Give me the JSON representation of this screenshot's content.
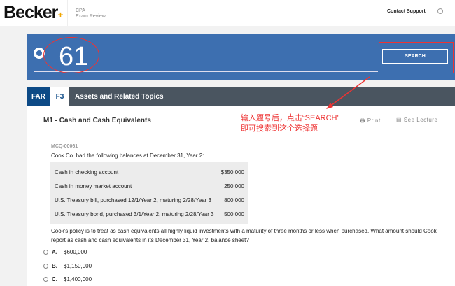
{
  "header": {
    "logo": "Becker",
    "product_line1": "CPA",
    "product_line2": "Exam Review",
    "contact": "Contact Support"
  },
  "search": {
    "value": "61",
    "button": "SEARCH"
  },
  "tabs": {
    "section": "FAR",
    "unit": "F3",
    "title": "Assets and Related Topics"
  },
  "module": {
    "title": "M1 - Cash and Cash Equivalents",
    "print": "Print",
    "see_lecture": "See Lecture"
  },
  "annotation": {
    "line1": "输入题号后，点击“SEARCH”",
    "line2": "即可搜索到这个选择题"
  },
  "question": {
    "id": "MCQ-00061",
    "intro": "Cook Co. had the following balances at December 31, Year 2:",
    "rows": [
      {
        "label": "Cash in checking account",
        "value": "$350,000"
      },
      {
        "label": "Cash in money market account",
        "value": "250,000"
      },
      {
        "label": "U.S. Treasury bill, purchased 12/1/Year 2, maturing 2/28/Year 3",
        "value": "800,000"
      },
      {
        "label": "U.S. Treasury bond, purchased 3/1/Year 2, maturing 2/28/Year 3",
        "value": "500,000"
      }
    ],
    "text": "Cook's policy is to treat as cash equivalents all highly liquid investments with a maturity of three months or less when purchased. What amount should Cook report as cash and cash equivalents in its December 31, Year 2, balance sheet?",
    "options": [
      {
        "letter": "A.",
        "value": "$600,000"
      },
      {
        "letter": "B.",
        "value": "$1,150,000"
      },
      {
        "letter": "C.",
        "value": "$1,400,000"
      }
    ]
  }
}
